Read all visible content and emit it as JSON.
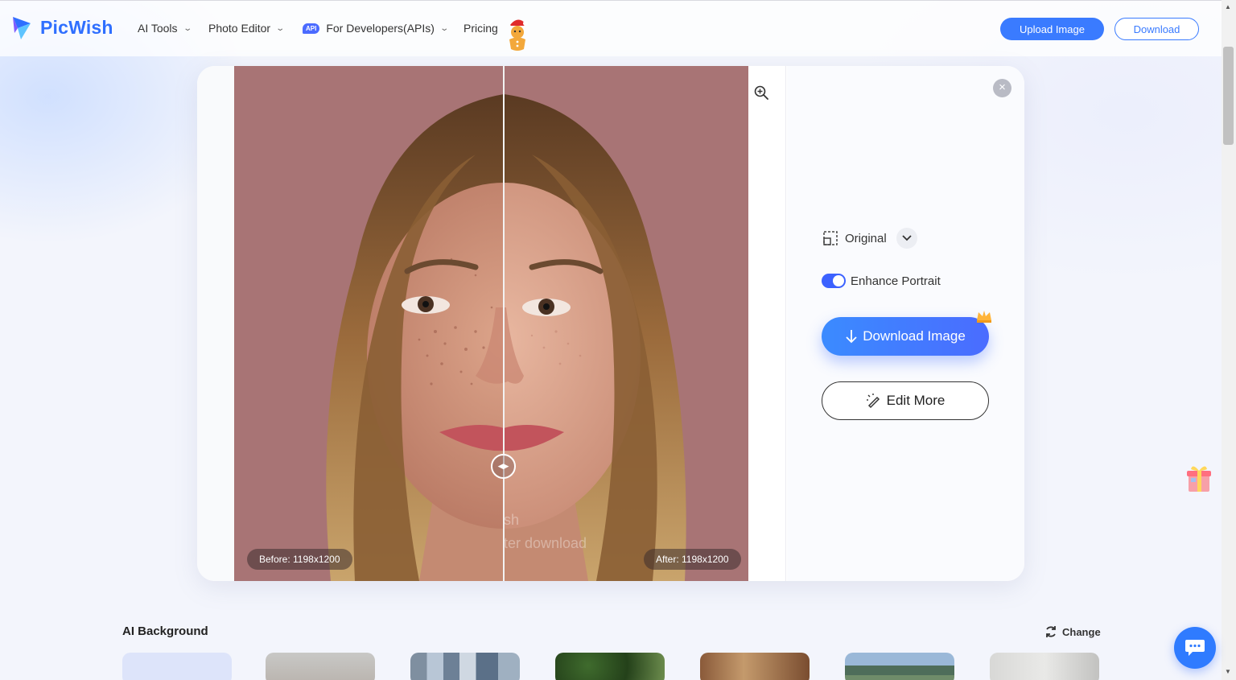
{
  "brand": {
    "name": "PicWish",
    "color": "#2f6fff"
  },
  "nav": {
    "items": [
      {
        "label": "AI Tools",
        "has_dropdown": true
      },
      {
        "label": "Photo Editor",
        "has_dropdown": true
      },
      {
        "label": "For Developers(APIs)",
        "has_dropdown": true,
        "badge": "API"
      },
      {
        "label": "Pricing",
        "has_dropdown": false
      }
    ],
    "upload_label": "Upload Image",
    "download_label": "Download"
  },
  "viewer": {
    "before_label": "Before: 1198x1200",
    "after_label": "After: 1198x1200",
    "watermark_line1": "sh",
    "watermark_line2": "ter download",
    "slider_position": 0.525
  },
  "panel": {
    "ratio_label": "Original",
    "toggle_label": "Enhance Portrait",
    "toggle_on": true,
    "download_image_label": "Download Image",
    "edit_more_label": "Edit More",
    "accent": "#3c62ff"
  },
  "ai_background": {
    "title": "AI Background",
    "change_label": "Change",
    "thumbnails": [
      "blank",
      "room-white",
      "city-buildings",
      "trees-garden",
      "wood-interior",
      "mountains",
      "window-room"
    ]
  }
}
